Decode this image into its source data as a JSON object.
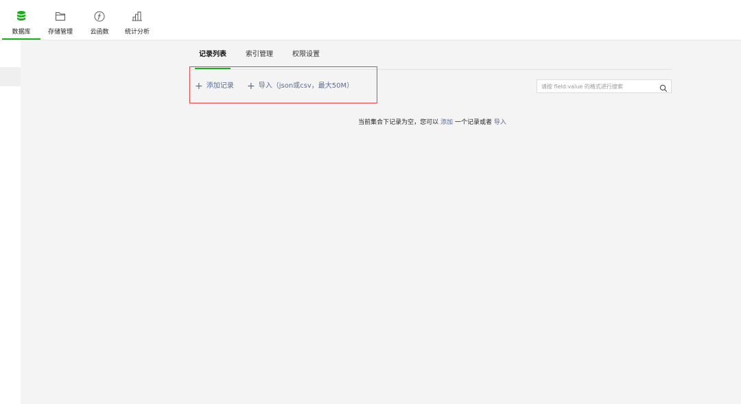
{
  "toolbar": {
    "items": [
      {
        "label": "数据库",
        "icon": "database-icon",
        "active": true
      },
      {
        "label": "存储管理",
        "icon": "folder-icon",
        "active": false
      },
      {
        "label": "云函数",
        "icon": "cloud-function-icon",
        "active": false
      },
      {
        "label": "统计分析",
        "icon": "bar-chart-icon",
        "active": false
      }
    ]
  },
  "tabs": [
    {
      "label": "记录列表",
      "active": true
    },
    {
      "label": "索引管理",
      "active": false
    },
    {
      "label": "权限设置",
      "active": false
    }
  ],
  "actions": {
    "add_record": "添加记录",
    "import": "导入（json或csv，最大50M）"
  },
  "search": {
    "placeholder": "请按 field:value 的格式进行搜索",
    "value": ""
  },
  "empty_state": {
    "prefix": "当前集合下记录为空，您可以",
    "add_link": "添加",
    "middle": "一个记录或者",
    "import_link": "导入"
  },
  "colors": {
    "accent": "#1aad19",
    "link": "#576b95",
    "highlight_box": "#e04848"
  }
}
